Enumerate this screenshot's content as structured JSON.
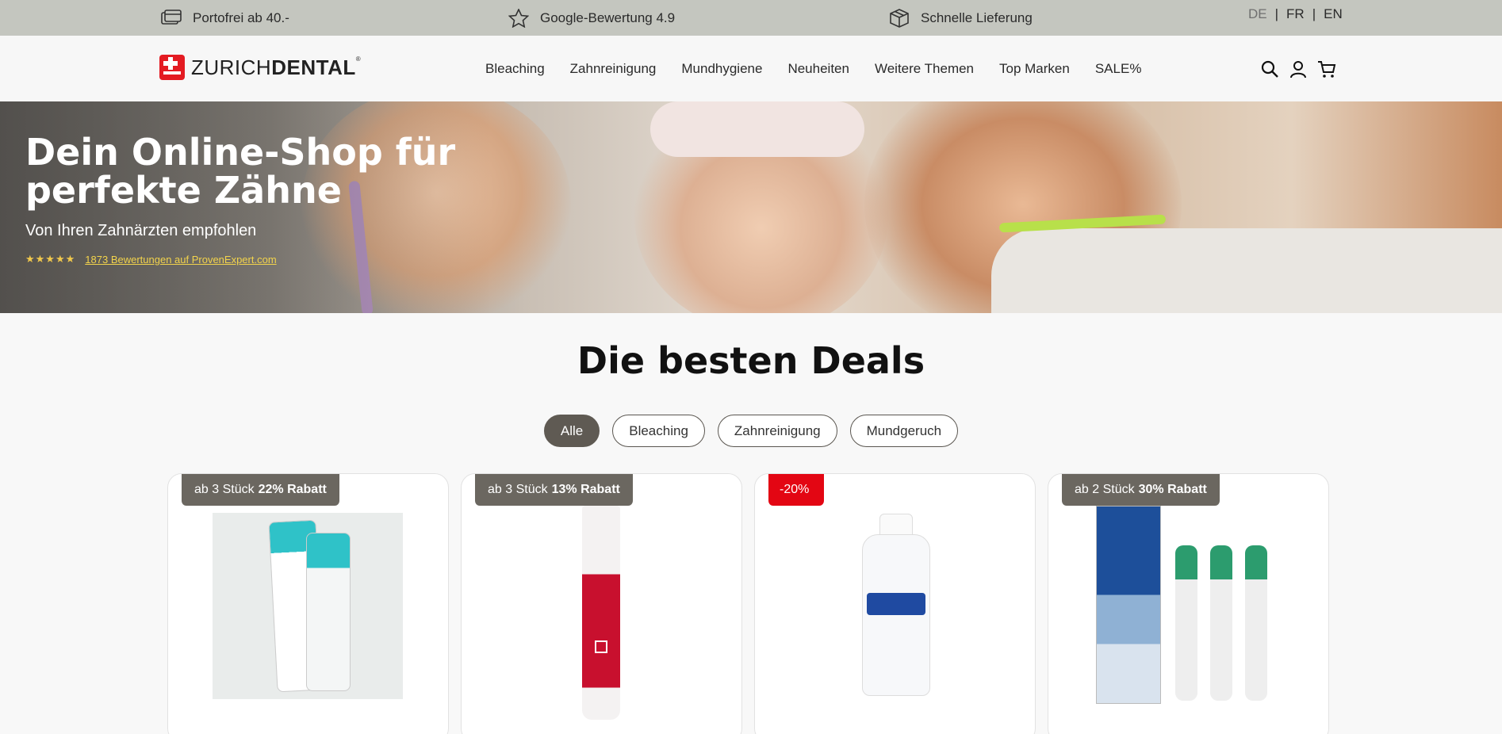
{
  "topbar": {
    "usps": [
      {
        "icon": "shipping-card-icon",
        "label": "Portofrei ab 40.-"
      },
      {
        "icon": "star-icon",
        "label": "Google-Bewertung 4.9"
      },
      {
        "icon": "package-box-icon",
        "label": "Schnelle Lieferung"
      }
    ],
    "languages": [
      "DE",
      "FR",
      "EN"
    ],
    "active_language": "DE"
  },
  "header": {
    "logo": {
      "part1": "ZURICH",
      "part2": "DENTAL",
      "mark": "®"
    },
    "nav": [
      "Bleaching",
      "Zahnreinigung",
      "Mundhygiene",
      "Neuheiten",
      "Weitere Themen",
      "Top Marken",
      "SALE%"
    ],
    "icons": [
      "search-icon",
      "user-icon",
      "cart-icon"
    ]
  },
  "hero": {
    "title": "Dein Online-Shop für perfekte Zähne",
    "subtitle": "Von Ihren Zahnärzten empfohlen",
    "stars": "★★★★★",
    "rating_link": "1873 Bewertungen auf ProvenExpert.com"
  },
  "deals": {
    "title": "Die besten Deals",
    "filters": [
      "Alle",
      "Bleaching",
      "Zahnreinigung",
      "Mundgeruch"
    ],
    "active_filter": "Alle",
    "products": [
      {
        "badge_prefix": "ab 3 Stück",
        "badge_bold": "22% Rabatt"
      },
      {
        "badge_prefix": "ab 3 Stück",
        "badge_bold": "13% Rabatt"
      },
      {
        "badge_prefix": "-20%",
        "badge_bold": ""
      },
      {
        "badge_prefix": "ab 2 Stück",
        "badge_bold": "30% Rabatt"
      }
    ]
  },
  "colors": {
    "topbar": "#c4c6bf",
    "brand_red": "#e41b22",
    "pill_active": "#5f5a53",
    "badge": "#6b6760",
    "badge_sale": "#e30613"
  }
}
